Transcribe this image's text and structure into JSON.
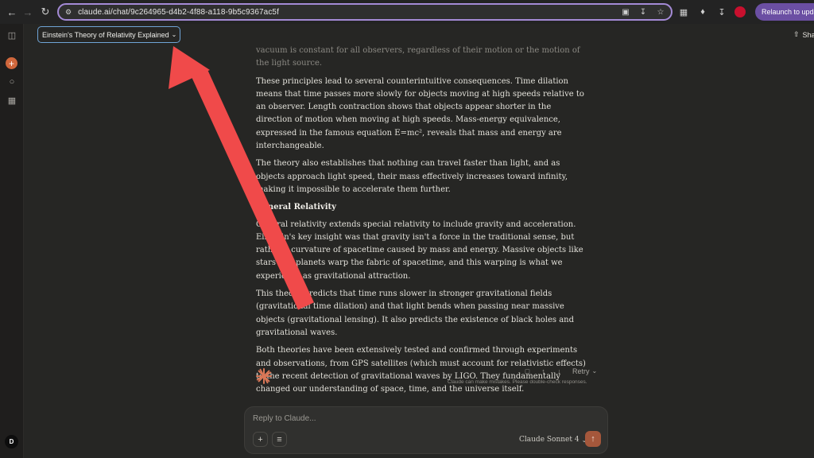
{
  "browser": {
    "url": "claude.ai/chat/9c264965-d4b2-4f88-a118-9b5c9367ac5f",
    "relaunch_label": "Relaunch to update",
    "icons": [
      "back-icon",
      "forward-icon",
      "reload-icon",
      "site-settings-icon",
      "cast-icon",
      "bookmark-star-icon",
      "extension-icon",
      "puzzle-icon",
      "download-icon",
      "profile-icon"
    ]
  },
  "header": {
    "chat_title": "Einstein's Theory of Relativity Explained",
    "share_label": "Share"
  },
  "sidebar": {
    "avatar_initial": "D"
  },
  "message": {
    "paragraphs": [
      "vacuum is constant for all observers, regardless of their motion or the motion of the light source.",
      "These principles lead to several counterintuitive consequences. Time dilation means that time passes more slowly for objects moving at high speeds relative to an observer. Length contraction shows that objects appear shorter in the direction of motion when moving at high speeds. Mass-energy equivalence, expressed in the famous equation E=mc², reveals that mass and energy are interchangeable.",
      "The theory also establishes that nothing can travel faster than light, and as objects approach light speed, their mass effectively increases toward infinity, making it impossible to accelerate them further."
    ],
    "heading": "General Relativity",
    "paragraphs2": [
      "General relativity extends special relativity to include gravity and acceleration. Einstein's key insight was that gravity isn't a force in the traditional sense, but rather a curvature of spacetime caused by mass and energy. Massive objects like stars and planets warp the fabric of spacetime, and this warping is what we experience as gravitational attraction.",
      "This theory predicts that time runs slower in stronger gravitational fields (gravitational time dilation) and that light bends when passing near massive objects (gravitational lensing). It also predicts the existence of black holes and gravitational waves.",
      "Both theories have been extensively tested and confirmed through experiments and observations, from GPS satellites (which must account for relativistic effects) to the recent detection of gravitational waves by LIGO. They fundamentally changed our understanding of space, time, and the universe itself."
    ],
    "retry_label": "Retry",
    "disclaimer": "Claude can make mistakes. Please double-check responses."
  },
  "composer": {
    "placeholder": "Reply to Claude...",
    "model_label": "Claude Sonnet 4"
  },
  "colors": {
    "accent_orange": "#d0673c",
    "send_button": "#a5573b",
    "annotation_arrow": "#f04a4a",
    "omnibox_focus": "#a48ad6",
    "title_focus": "#6fa4d6"
  }
}
